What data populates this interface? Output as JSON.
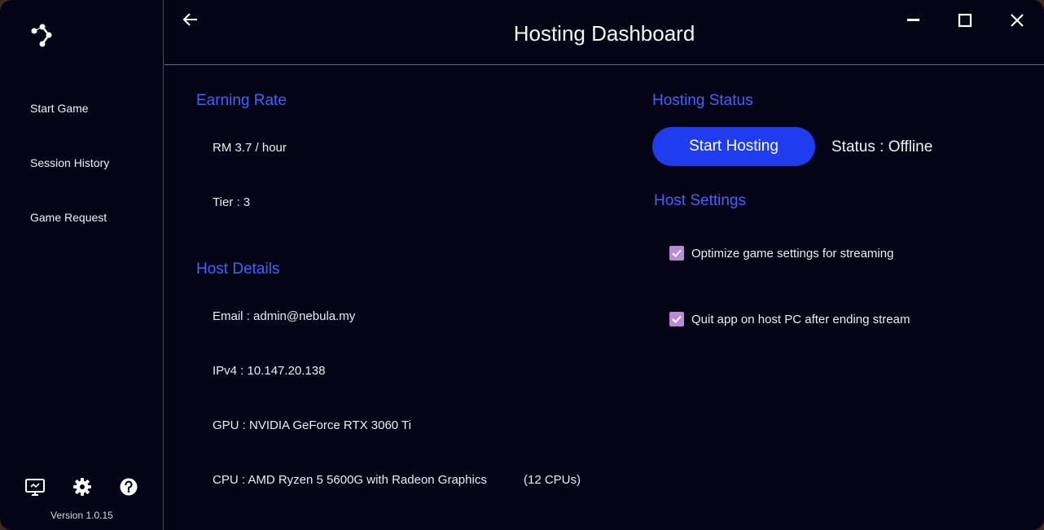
{
  "window": {
    "title": "Hosting Dashboard"
  },
  "sidebar": {
    "items": [
      {
        "label": "Start Game"
      },
      {
        "label": "Session History"
      },
      {
        "label": "Game Request"
      }
    ],
    "footer_icons": [
      "monitor-icon",
      "gear-icon",
      "help-icon"
    ],
    "version": "Version 1.0.15"
  },
  "earning": {
    "heading": "Earning Rate",
    "rate": "RM 3.7 / hour",
    "tier": "Tier : 3"
  },
  "host_details": {
    "heading": "Host Details",
    "email": "Email : admin@nebula.my",
    "ipv4": "IPv4 : 10.147.20.138",
    "gpu": "GPU : NVIDIA GeForce RTX 3060 Ti",
    "cpu": "CPU : AMD Ryzen 5 5600G with Radeon Graphics",
    "cpu_count": "(12 CPUs)"
  },
  "hosting_status": {
    "heading": "Hosting Status",
    "button_label": "Start Hosting",
    "status": "Status : Offline"
  },
  "host_settings": {
    "heading": "Host Settings",
    "options": [
      {
        "label": "Optimize game settings for streaming",
        "checked": true
      },
      {
        "label": "Quit app on host PC after ending stream",
        "checked": true
      }
    ]
  },
  "colors": {
    "background": "#050417",
    "accent": "#3f63ff",
    "button": "#1f3cf0",
    "checkbox": "#b98bd6"
  }
}
